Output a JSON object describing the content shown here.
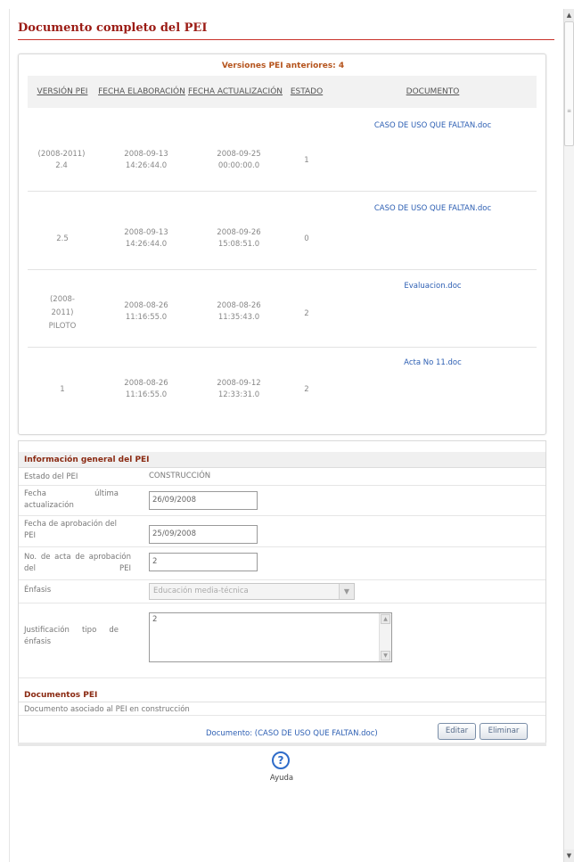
{
  "page_title": "Documento completo del PEI",
  "versions": {
    "caption": "Versiones PEI anteriores: 4",
    "headers": [
      "VERSIÓN PEI",
      "FECHA ELABORACIÓN",
      "FECHA ACTUALIZACIÓN",
      "ESTADO",
      "DOCUMENTO"
    ],
    "rows": [
      {
        "version": "(2008-2011) 2.4",
        "fecha_elab": "2008-09-13 14:26:44.0",
        "fecha_act": "2008-09-25 00:00:00.0",
        "estado": "1",
        "documento": "CASO DE USO QUE FALTAN.doc"
      },
      {
        "version": "2.5",
        "fecha_elab": "2008-09-13 14:26:44.0",
        "fecha_act": "2008-09-26 15:08:51.0",
        "estado": "0",
        "documento": "CASO DE USO QUE FALTAN.doc"
      },
      {
        "version": "(2008-2011) PILOTO",
        "fecha_elab": "2008-08-26 11:16:55.0",
        "fecha_act": "2008-08-26 11:35:43.0",
        "estado": "2",
        "documento": "Evaluacion.doc"
      },
      {
        "version": "1",
        "fecha_elab": "2008-08-26 11:16:55.0",
        "fecha_act": "2008-09-12 12:33:31.0",
        "estado": "2",
        "documento": "Acta No 11.doc"
      }
    ]
  },
  "info": {
    "heading": "Información general del PEI",
    "estado_label": "Estado del PEI",
    "estado_value": "CONSTRUCCIÓN",
    "fecha_act_label": "Fecha última actualización",
    "fecha_act_value": "26/09/2008",
    "fecha_apr_label": "Fecha de aprobación del PEI",
    "fecha_apr_value": "25/09/2008",
    "acta_label": "No. de acta de aprobación del PEI",
    "acta_value": "2",
    "enfasis_label": "Énfasis",
    "enfasis_value": "Educación media-técnica",
    "justificacion_label": "Justificación tipo de énfasis",
    "justificacion_value": "2"
  },
  "docs": {
    "heading": "Documentos PEI",
    "description": "Documento asociado al PEI en construcción",
    "document_link": "Documento: (CASO DE USO QUE FALTAN.doc)",
    "edit_label": "Editar",
    "delete_label": "Eliminar"
  },
  "help": {
    "icon": "question-circle-icon",
    "label": "Ayuda"
  }
}
